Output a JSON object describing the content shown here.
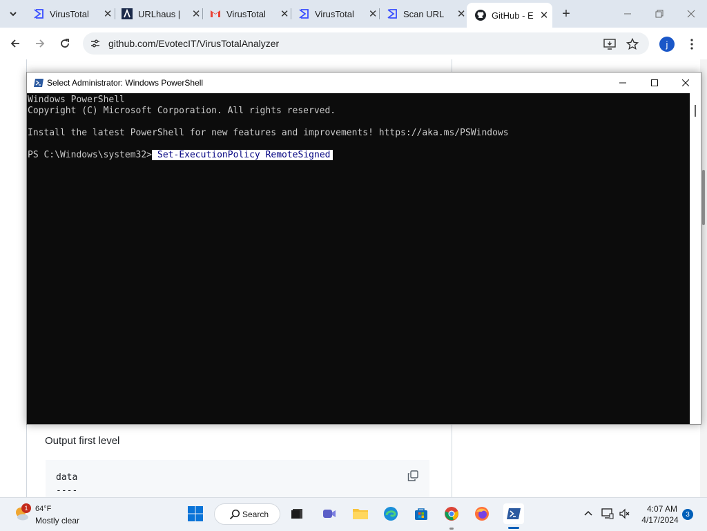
{
  "browser": {
    "tabs": [
      {
        "label": "VirusTotal",
        "icon": "virustotal-icon"
      },
      {
        "label": "URLhaus |",
        "icon": "urlhaus-icon"
      },
      {
        "label": "VirusTotal",
        "icon": "gmail-icon"
      },
      {
        "label": "VirusTotal",
        "icon": "virustotal-icon"
      },
      {
        "label": "Scan URL",
        "icon": "virustotal-icon"
      },
      {
        "label": "GitHub - E",
        "icon": "github-icon"
      }
    ],
    "new_tab": "+",
    "address": "github.com/EvotecIT/VirusTotalAnalyzer",
    "profile_initial": "j"
  },
  "page": {
    "heading": "Output first level",
    "code_lines": [
      "data",
      "----"
    ]
  },
  "powershell": {
    "title": "Select Administrator: Windows PowerShell",
    "lines": [
      "Windows PowerShell",
      "Copyright (C) Microsoft Corporation. All rights reserved.",
      "",
      "Install the latest PowerShell for new features and improvements! https://aka.ms/PSWindows",
      ""
    ],
    "prompt": "PS C:\\Windows\\system32>",
    "command": "Set-ExecutionPolicy RemoteSigned"
  },
  "taskbar": {
    "weather_temp": "64°F",
    "weather_desc": "Mostly clear",
    "weather_badge": "1",
    "search_label": "Search",
    "time": "4:07 AM",
    "date": "4/17/2024",
    "notifications": "3"
  },
  "colors": {
    "console_bg": "#0c0c0c",
    "console_text": "#cccccc",
    "accent": "#005fb8"
  }
}
